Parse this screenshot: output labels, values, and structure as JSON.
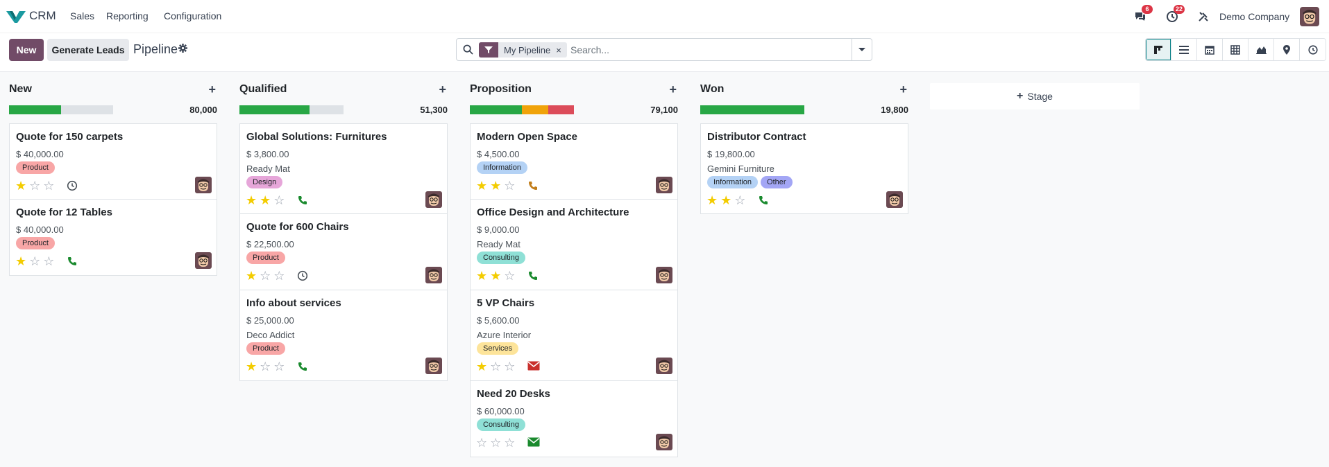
{
  "navbar": {
    "app_name": "CRM",
    "menu": [
      "Sales",
      "Reporting",
      "Configuration"
    ],
    "messages_count": "6",
    "activities_count": "22",
    "company": "Demo Company",
    "brand_color": "#714B67"
  },
  "control": {
    "new_label": "New",
    "generate_label": "Generate Leads",
    "breadcrumb": "Pipeline",
    "search": {
      "facet": "My Pipeline",
      "facet_remove": "×",
      "placeholder": "Search..."
    },
    "views": [
      "kanban-icon",
      "list-icon",
      "calendar-icon",
      "pivot-icon",
      "graph-icon",
      "map-icon",
      "activity-icon"
    ],
    "active_view": "kanban-icon"
  },
  "columns": [
    {
      "name": "New",
      "total": "80,000",
      "progress": [
        {
          "color": "#28a745",
          "fraction": 0.5
        }
      ],
      "cards": [
        {
          "title": "Quote for 150 carpets",
          "amount": "$ 40,000.00",
          "company": "",
          "tags": [
            {
              "label": "Product",
              "color": "#f8a6a6"
            }
          ],
          "stars": 1,
          "activity": "clock"
        },
        {
          "title": "Quote for 12 Tables",
          "amount": "$ 40,000.00",
          "company": "",
          "tags": [
            {
              "label": "Product",
              "color": "#f8a6a6"
            }
          ],
          "stars": 1,
          "activity": "phone"
        }
      ]
    },
    {
      "name": "Qualified",
      "total": "51,300",
      "progress": [
        {
          "color": "#28a745",
          "fraction": 0.67
        }
      ],
      "cards": [
        {
          "title": "Global Solutions: Furnitures",
          "amount": "$ 3,800.00",
          "company": "Ready Mat",
          "tags": [
            {
              "label": "Design",
              "color": "#e6a6d9"
            }
          ],
          "stars": 2,
          "activity": "phone"
        },
        {
          "title": "Quote for 600 Chairs",
          "amount": "$ 22,500.00",
          "company": "",
          "tags": [
            {
              "label": "Product",
              "color": "#f8a6a6"
            }
          ],
          "stars": 1,
          "activity": "clock"
        },
        {
          "title": "Info about services",
          "amount": "$ 25,000.00",
          "company": "Deco Addict",
          "tags": [
            {
              "label": "Product",
              "color": "#f8a6a6"
            }
          ],
          "stars": 1,
          "activity": "phone"
        }
      ]
    },
    {
      "name": "Proposition",
      "total": "79,100",
      "progress": [
        {
          "color": "#28a745",
          "fraction": 0.5
        },
        {
          "color": "#f0a30a",
          "fraction": 0.25
        },
        {
          "color": "#dc4c5a",
          "fraction": 0.25
        }
      ],
      "cards": [
        {
          "title": "Modern Open Space",
          "amount": "$ 4,500.00",
          "company": "",
          "tags": [
            {
              "label": "Information",
              "color": "#b4d2f5"
            }
          ],
          "stars": 2,
          "activity": "phone-orange"
        },
        {
          "title": "Office Design and Architecture",
          "amount": "$ 9,000.00",
          "company": "Ready Mat",
          "tags": [
            {
              "label": "Consulting",
              "color": "#8fe0d6"
            }
          ],
          "stars": 2,
          "activity": "phone"
        },
        {
          "title": "5 VP Chairs",
          "amount": "$ 5,600.00",
          "company": "Azure Interior",
          "tags": [
            {
              "label": "Services",
              "color": "#fde49a"
            }
          ],
          "stars": 1,
          "activity": "email-red"
        },
        {
          "title": "Need 20 Desks",
          "amount": "$ 60,000.00",
          "company": "",
          "tags": [
            {
              "label": "Consulting",
              "color": "#8fe0d6"
            }
          ],
          "stars": 0,
          "activity": "email-green"
        }
      ]
    },
    {
      "name": "Won",
      "total": "19,800",
      "progress": [
        {
          "color": "#28a745",
          "fraction": 1.0
        }
      ],
      "cards": [
        {
          "title": "Distributor Contract",
          "amount": "$ 19,800.00",
          "company": "Gemini Furniture",
          "tags": [
            {
              "label": "Information",
              "color": "#b4d2f5"
            },
            {
              "label": "Other",
              "color": "#a3a6f5"
            }
          ],
          "stars": 2,
          "activity": "phone"
        }
      ]
    }
  ],
  "add_stage_label": "Stage"
}
